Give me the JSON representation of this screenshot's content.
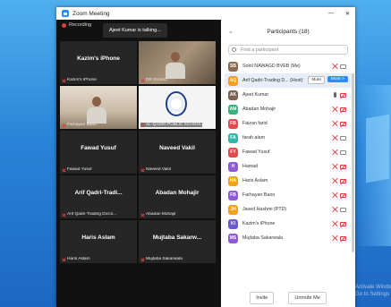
{
  "window": {
    "title": "Zoom Meeting",
    "controls": [
      "—",
      "✕"
    ]
  },
  "meeting": {
    "recording": "Recording",
    "speaking": "Ajeet Kumar is talking...",
    "tiles": [
      {
        "name": "Kazim's iPhone",
        "label": "Kazim's iPhone",
        "video": "none"
      },
      {
        "name": "",
        "label": "DR SAJAD",
        "video": "a"
      },
      {
        "name": "",
        "label": "Farhayan Bano",
        "video": "b"
      },
      {
        "name": "",
        "label": "AL-QADRI PUBLIC SCHOOL",
        "video": "c"
      },
      {
        "name": "Fawad Yusuf",
        "label": "Fawad Yusuf",
        "video": "none"
      },
      {
        "name": "Naveed Vakil",
        "label": "Naveed Vakil",
        "video": "none"
      },
      {
        "name": "Arif Qadri-Tradi...",
        "label": "Arif Qadri-Trading Dicco...",
        "video": "none"
      },
      {
        "name": "Abadan Mohajir",
        "label": "Abadan Mohajir",
        "video": "none"
      },
      {
        "name": "Haris Aslam",
        "label": "Haris Aslam",
        "video": "none"
      },
      {
        "name": "Mujtaba Sakarw...",
        "label": "Mujtaba Sakarwala",
        "video": "none"
      }
    ]
  },
  "panel": {
    "title": "Participants (18)",
    "search_placeholder": "Find a participant",
    "participants": [
      {
        "initials": "SB",
        "name": "Sohil NAWAGD BVEB (Me)",
        "color": "#8a6a50",
        "mic": "off",
        "cam": "on"
      },
      {
        "initials": "AQ",
        "name": "Arif Qadri-Trading D... (Host)",
        "color": "#f3a01a",
        "mic": "off",
        "cam": "on",
        "mute_label": "Mute",
        "more_label": "More >",
        "highlight": true
      },
      {
        "initials": "AK",
        "name": "Ajeet Kumar",
        "color": "#7b6354",
        "mic": "on",
        "cam": "off"
      },
      {
        "initials": "AM",
        "name": "Abadan Mohajir",
        "color": "#3bb07c",
        "mic": "off",
        "cam": "off"
      },
      {
        "initials": "FB",
        "name": "Faizan farid",
        "color": "#e14b4b",
        "mic": "off",
        "cam": "off"
      },
      {
        "initials": "FA",
        "name": "farah alam",
        "color": "#33b5a8",
        "mic": "off",
        "cam": "on"
      },
      {
        "initials": "FY",
        "name": "Fawad Yusuf",
        "color": "#e14b4b",
        "mic": "off",
        "cam": "on"
      },
      {
        "initials": "H",
        "name": "Hamad",
        "color": "#8e5ad6",
        "mic": "off",
        "cam": "off"
      },
      {
        "initials": "HA",
        "name": "Haris Aslam",
        "color": "#f3a01a",
        "mic": "off",
        "cam": "off"
      },
      {
        "initials": "FB",
        "name": "Farhayan Bano",
        "color": "#8e5ad6",
        "mic": "off",
        "cam": "off"
      },
      {
        "initials": "JH",
        "name": "Javed Hashmi (PTD)",
        "color": "#f3a01a",
        "mic": "off",
        "cam": "on"
      },
      {
        "initials": "KI",
        "name": "Kazim's iPhone",
        "color": "#6a5ad6",
        "mic": "off",
        "cam": "off"
      },
      {
        "initials": "MS",
        "name": "Mujtaba Sakarwala",
        "color": "#8e5ad6",
        "mic": "off",
        "cam": "off"
      }
    ],
    "invite_label": "Invite",
    "unmute_all_label": "Unmute Me"
  },
  "desktop": {
    "watermark": "Activate Windows\nGo to Settings"
  }
}
